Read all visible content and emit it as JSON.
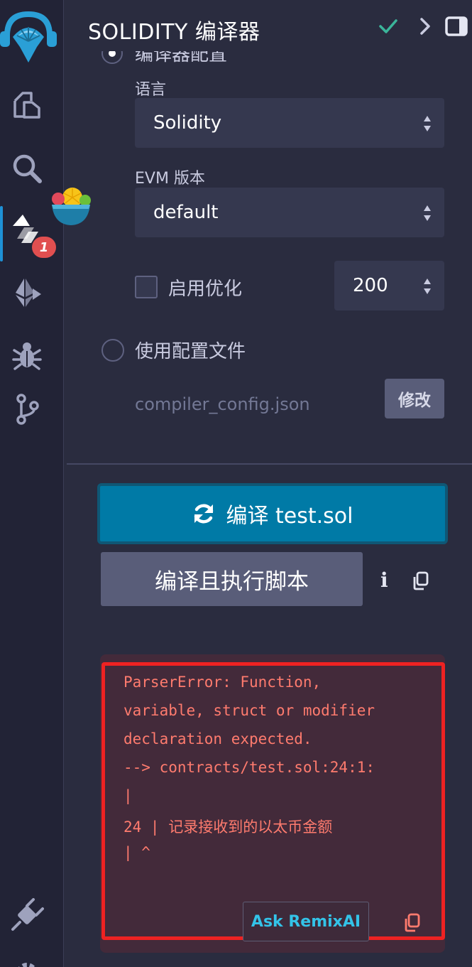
{
  "header": {
    "title": "SOLIDITY 编译器"
  },
  "rail": {
    "badge_count": "1"
  },
  "config": {
    "compiler_config_label": "编译器配置",
    "language_label": "语言",
    "language_value": "Solidity",
    "evm_label": "EVM 版本",
    "evm_value": "default",
    "optimize_label": "启用优化",
    "runs_value": "200",
    "use_config_file_label": "使用配置文件",
    "config_file_path": "compiler_config.json",
    "edit_label": "修改"
  },
  "actions": {
    "compile_label": "编译 test.sol",
    "compile_script_label": "编译且执行脚本",
    "info_label": "i"
  },
  "error": {
    "lines": [
      "ParserError: Function,",
      "variable, struct or modifier",
      "declaration expected.",
      "--> contracts/test.sol:24:1:",
      "|",
      "24 | 记录接收到的以太币金额",
      "| ^"
    ],
    "ask_ai_label": "Ask RemixAI"
  },
  "colors": {
    "accent": "#007aa6",
    "error_text": "#ff7b6e",
    "error_border": "#ee2222",
    "success_check": "#3bb59a"
  }
}
